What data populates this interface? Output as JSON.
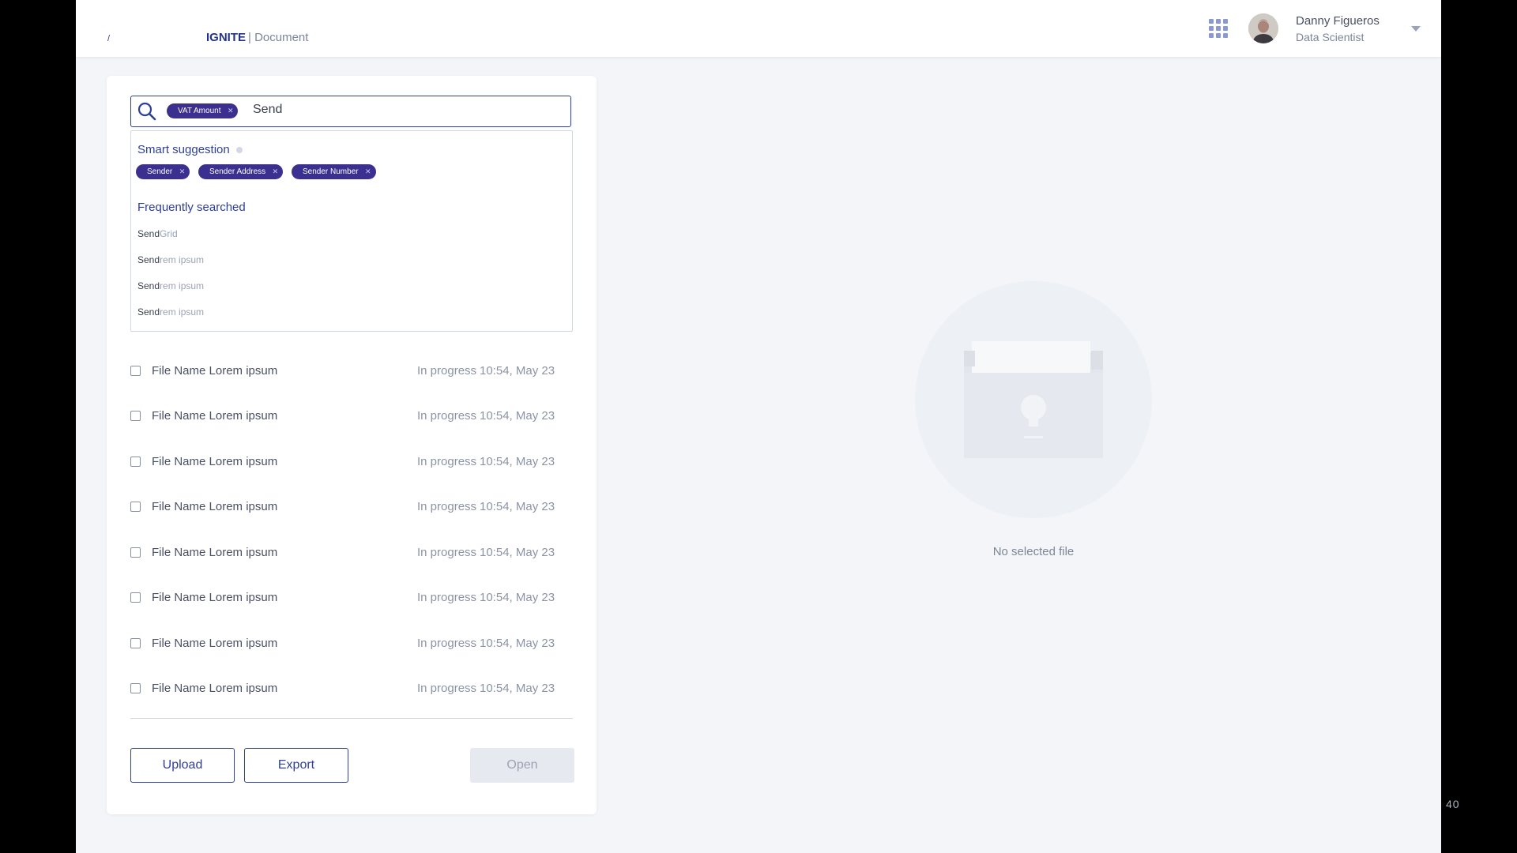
{
  "header": {
    "logo_mark": "/",
    "product_name": "IGNITE",
    "section": "| Document",
    "user": {
      "name": "Danny Figueros",
      "role": "Data Scientist"
    }
  },
  "search": {
    "active_chip": "VAT Amount",
    "query": "Send"
  },
  "suggestions": {
    "smart_title": "Smart suggestion",
    "smart_chips": [
      "Sender",
      "Sender Address",
      "Sender Number"
    ],
    "frequent_title": "Frequently searched",
    "frequent_items": [
      {
        "match": "Send",
        "rest": "Grid"
      },
      {
        "match": "Send",
        "rest": "rem ipsum"
      },
      {
        "match": "Send",
        "rest": "rem ipsum"
      },
      {
        "match": "Send",
        "rest": "rem ipsum"
      }
    ]
  },
  "files": [
    {
      "name": "File Name Lorem ipsum",
      "status": "In progress",
      "date": "10:54, May 23"
    },
    {
      "name": "File Name Lorem ipsum",
      "status": "In progress",
      "date": "10:54, May 23"
    },
    {
      "name": "File Name Lorem ipsum",
      "status": "In progress",
      "date": "10:54, May 23"
    },
    {
      "name": "File Name Lorem ipsum",
      "status": "In progress",
      "date": "10:54, May 23"
    },
    {
      "name": "File Name Lorem ipsum",
      "status": "In progress",
      "date": "10:54, May 23"
    },
    {
      "name": "File Name Lorem ipsum",
      "status": "In progress",
      "date": "10:54, May 23"
    },
    {
      "name": "File Name Lorem ipsum",
      "status": "In progress",
      "date": "10:54, May 23"
    },
    {
      "name": "File Name Lorem ipsum",
      "status": "In progress",
      "date": "10:54, May 23"
    }
  ],
  "actions": {
    "upload": "Upload",
    "export": "Export",
    "open": "Open"
  },
  "preview": {
    "empty_text": "No selected file"
  },
  "page_number": "40"
}
